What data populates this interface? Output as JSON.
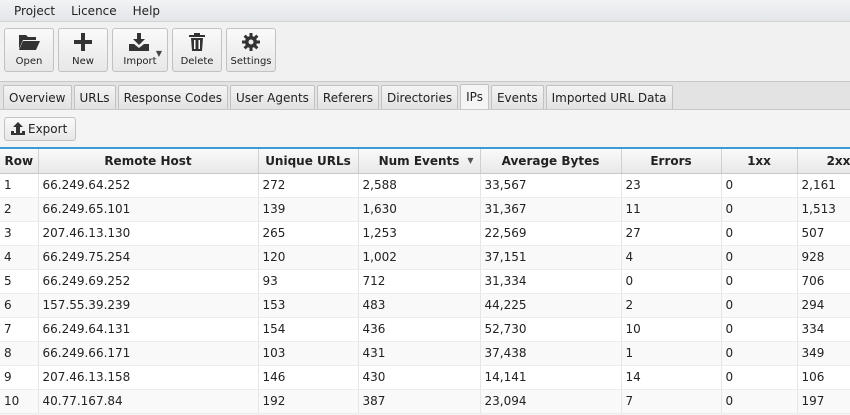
{
  "menu": [
    "Project",
    "Licence",
    "Help"
  ],
  "toolbar": [
    {
      "label": "Open",
      "icon": "folder-open-icon"
    },
    {
      "label": "New",
      "icon": "plus-icon"
    },
    {
      "label": "Import",
      "icon": "download-icon"
    },
    {
      "label": "Delete",
      "icon": "trash-icon"
    },
    {
      "label": "Settings",
      "icon": "gear-icon"
    }
  ],
  "tabs": [
    "Overview",
    "URLs",
    "Response Codes",
    "User Agents",
    "Referers",
    "Directories",
    "IPs",
    "Events",
    "Imported URL Data"
  ],
  "active_tab": "IPs",
  "export_label": "Export",
  "accent": "#3c9bd6",
  "table": {
    "columns": [
      "Row",
      "Remote Host",
      "Unique URLs",
      "Num Events",
      "Average Bytes",
      "Errors",
      "1xx",
      "2xx"
    ],
    "sorted_column": "Num Events",
    "sort_direction": "descending",
    "rows": [
      [
        "1",
        "66.249.64.252",
        "272",
        "2,588",
        "33,567",
        "23",
        "0",
        "2,161"
      ],
      [
        "2",
        "66.249.65.101",
        "139",
        "1,630",
        "31,367",
        "11",
        "0",
        "1,513"
      ],
      [
        "3",
        "207.46.13.130",
        "265",
        "1,253",
        "22,569",
        "27",
        "0",
        "507"
      ],
      [
        "4",
        "66.249.75.254",
        "120",
        "1,002",
        "37,151",
        "4",
        "0",
        "928"
      ],
      [
        "5",
        "66.249.69.252",
        "93",
        "712",
        "31,334",
        "0",
        "0",
        "706"
      ],
      [
        "6",
        "157.55.39.239",
        "153",
        "483",
        "44,225",
        "2",
        "0",
        "294"
      ],
      [
        "7",
        "66.249.64.131",
        "154",
        "436",
        "52,730",
        "10",
        "0",
        "334"
      ],
      [
        "8",
        "66.249.66.171",
        "103",
        "431",
        "37,438",
        "1",
        "0",
        "349"
      ],
      [
        "9",
        "207.46.13.158",
        "146",
        "430",
        "14,141",
        "14",
        "0",
        "106"
      ],
      [
        "10",
        "40.77.167.84",
        "192",
        "387",
        "23,094",
        "7",
        "0",
        "197"
      ]
    ]
  }
}
